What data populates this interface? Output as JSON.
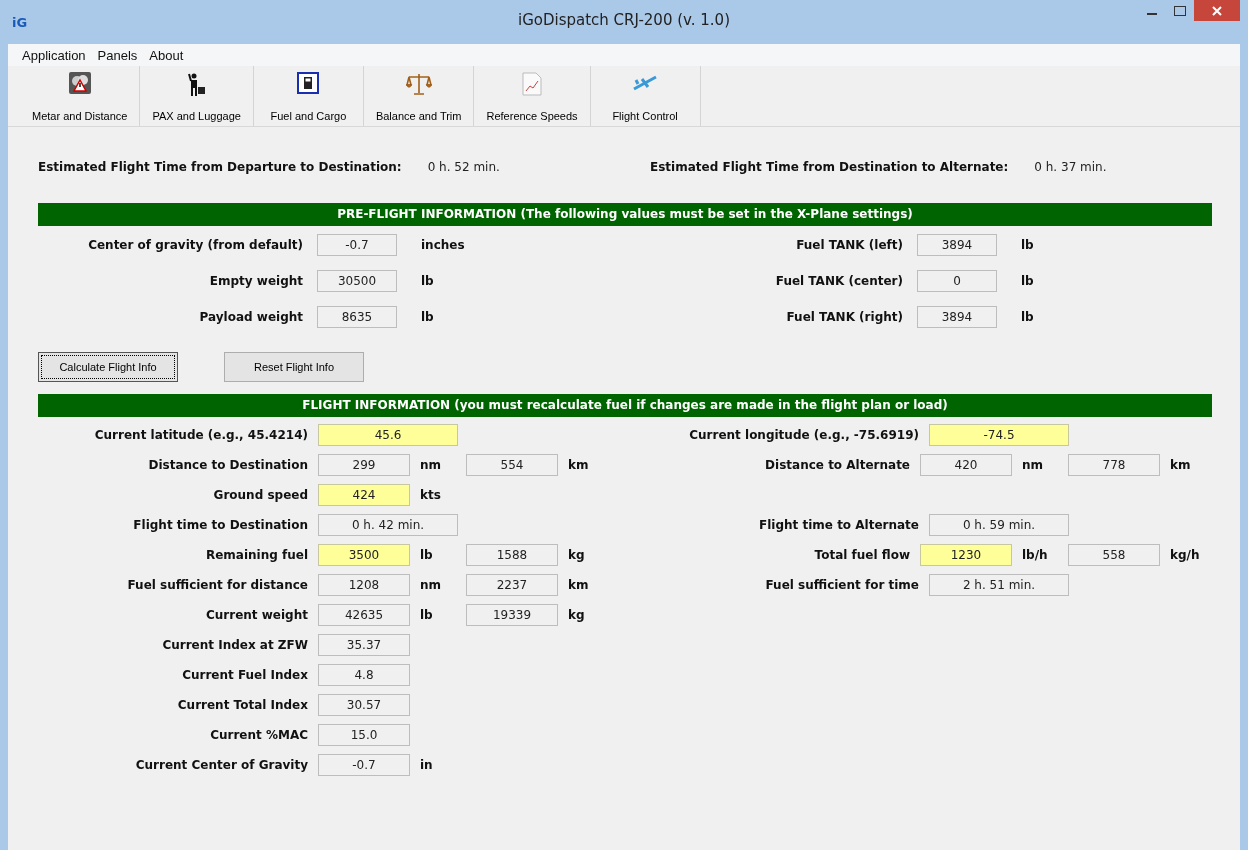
{
  "window": {
    "title": "iGoDispatch CRJ-200 (v. 1.0)",
    "logo": "iG"
  },
  "menu": [
    "Application",
    "Panels",
    "About"
  ],
  "toolbar": [
    {
      "label": "Metar and Distance",
      "kind": "weather"
    },
    {
      "label": "PAX and Luggage",
      "kind": "passenger"
    },
    {
      "label": "Fuel and Cargo",
      "kind": "fuel"
    },
    {
      "label": "Balance and Trim",
      "kind": "scales"
    },
    {
      "label": "Reference Speeds",
      "kind": "chart"
    },
    {
      "label": "Flight Control",
      "kind": "plane"
    }
  ],
  "estimates": [
    {
      "label": "Estimated Flight Time from Departure to Destination:",
      "value": "0 h. 52 min."
    },
    {
      "label": "Estimated Flight Time from Destination to Alternate:",
      "value": "0 h. 37 min."
    }
  ],
  "preflight": {
    "title": "PRE-FLIGHT INFORMATION (The following values must be set in the X-Plane settings)",
    "left": [
      {
        "label": "Center of gravity (from default)",
        "value": "-0.7",
        "unit": "inches"
      },
      {
        "label": "Empty weight",
        "value": "30500",
        "unit": "lb"
      },
      {
        "label": "Payload weight",
        "value": "8635",
        "unit": "lb"
      }
    ],
    "right": [
      {
        "label": "Fuel TANK (left)",
        "value": "3894",
        "unit": "lb"
      },
      {
        "label": "Fuel TANK (center)",
        "value": "0",
        "unit": "lb"
      },
      {
        "label": "Fuel TANK (right)",
        "value": "3894",
        "unit": "lb"
      }
    ]
  },
  "buttons": [
    {
      "label": "Calculate Flight Info",
      "focused": true
    },
    {
      "label": "Reset Flight Info",
      "focused": false
    }
  ],
  "flight_info": {
    "title": "FLIGHT INFORMATION (you must recalculate fuel if changes are made in the flight plan or load)",
    "rows": [
      {
        "left": {
          "label": "Current latitude (e.g., 45.4214)",
          "fields": [
            {
              "value": "45.6",
              "kind": "wide",
              "editable": true
            }
          ]
        },
        "right": {
          "label": "Current longitude (e.g., -75.6919)",
          "fields": [
            {
              "value": "-74.5",
              "kind": "wide",
              "editable": true
            }
          ]
        }
      },
      {
        "left": {
          "label": "Distance to Destination",
          "fields": [
            {
              "value": "299",
              "kind": "short",
              "editable": false,
              "unit": "nm"
            },
            {
              "value": "554",
              "kind": "short",
              "editable": false,
              "unit": "km"
            }
          ]
        },
        "right": {
          "label": "Distance to Alternate",
          "fields": [
            {
              "value": "420",
              "kind": "short",
              "editable": false,
              "unit": "nm"
            },
            {
              "value": "778",
              "kind": "short",
              "editable": false,
              "unit": "km"
            }
          ]
        }
      },
      {
        "left": {
          "label": "Ground speed",
          "fields": [
            {
              "value": "424",
              "kind": "short",
              "editable": true,
              "unit": "kts"
            }
          ]
        }
      },
      {
        "left": {
          "label": "Flight time to Destination",
          "fields": [
            {
              "value": "0 h. 42 min.",
              "kind": "wide",
              "editable": false
            }
          ]
        },
        "right": {
          "label": "Flight time to Alternate",
          "fields": [
            {
              "value": "0 h. 59 min.",
              "kind": "wide",
              "editable": false
            }
          ]
        }
      },
      {
        "left": {
          "label": "Remaining fuel",
          "fields": [
            {
              "value": "3500",
              "kind": "short",
              "editable": true,
              "unit": "lb"
            },
            {
              "value": "1588",
              "kind": "short",
              "editable": false,
              "unit": "kg"
            }
          ]
        },
        "right": {
          "label": "Total fuel flow",
          "fields": [
            {
              "value": "1230",
              "kind": "short",
              "editable": true,
              "unit": "lb/h"
            },
            {
              "value": "558",
              "kind": "short",
              "editable": false,
              "unit": "kg/h"
            }
          ]
        }
      },
      {
        "left": {
          "label": "Fuel sufficient for distance",
          "fields": [
            {
              "value": "1208",
              "kind": "short",
              "editable": false,
              "unit": "nm"
            },
            {
              "value": "2237",
              "kind": "short",
              "editable": false,
              "unit": "km"
            }
          ]
        },
        "right": {
          "label": "Fuel sufficient for time",
          "fields": [
            {
              "value": "2 h. 51 min.",
              "kind": "wide",
              "editable": false
            }
          ]
        }
      },
      {
        "left": {
          "label": "Current weight",
          "fields": [
            {
              "value": "42635",
              "kind": "short",
              "editable": false,
              "unit": "lb"
            },
            {
              "value": "19339",
              "kind": "short",
              "editable": false,
              "unit": "kg"
            }
          ]
        }
      },
      {
        "left": {
          "label": "Current Index at ZFW",
          "fields": [
            {
              "value": "35.37",
              "kind": "short",
              "editable": false
            }
          ]
        }
      },
      {
        "left": {
          "label": "Current Fuel Index",
          "fields": [
            {
              "value": "4.8",
              "kind": "short",
              "editable": false
            }
          ]
        }
      },
      {
        "left": {
          "label": "Current Total Index",
          "fields": [
            {
              "value": "30.57",
              "kind": "short",
              "editable": false
            }
          ]
        }
      },
      {
        "left": {
          "label": "Current %MAC",
          "fields": [
            {
              "value": "15.0",
              "kind": "short",
              "editable": false
            }
          ]
        }
      },
      {
        "left": {
          "label": "Current Center of Gravity",
          "fields": [
            {
              "value": "-0.7",
              "kind": "short",
              "editable": false,
              "unit": "in"
            }
          ]
        }
      }
    ]
  }
}
